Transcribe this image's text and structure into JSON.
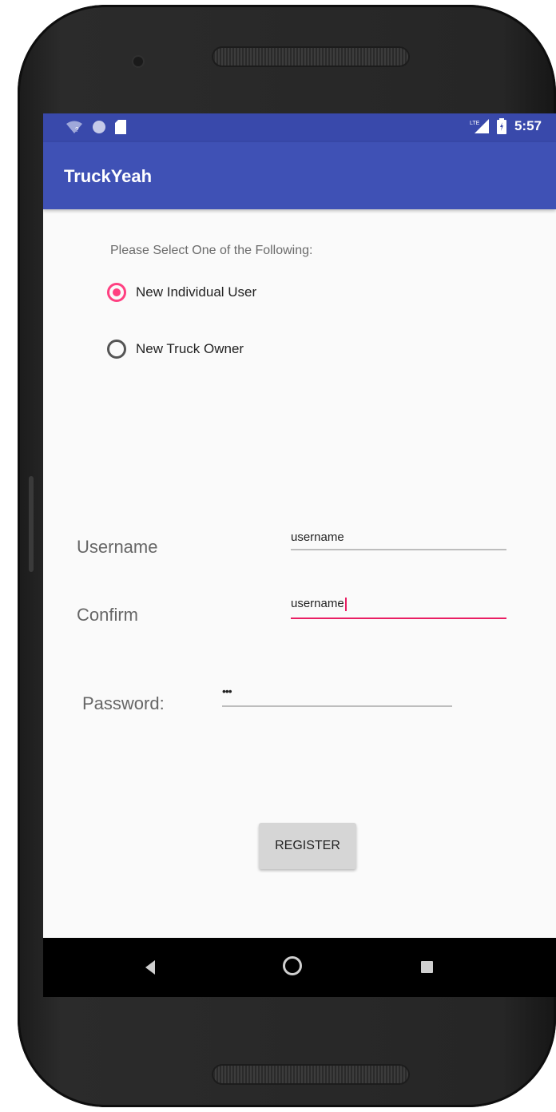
{
  "status_bar": {
    "time": "5:57",
    "icons": [
      "wifi-icon",
      "circle-notification-icon",
      "sd-card-icon",
      "lte-signal-icon",
      "battery-icon"
    ]
  },
  "app": {
    "title": "TruckYeah",
    "primary_color": "#3f51b5",
    "status_bar_color": "#3949ab",
    "accent_color": "#ff4081"
  },
  "form": {
    "prompt": "Please Select One of the Following:",
    "options": [
      {
        "label": "New Individual User",
        "checked": true
      },
      {
        "label": "New Truck Owner",
        "checked": false
      }
    ],
    "username_label": "Username",
    "username_value": "username",
    "confirm_label": "Confirm",
    "confirm_value": "username",
    "password_label": "Password:",
    "password_value": "•••",
    "register_label": "REGISTER"
  },
  "nav_bar": {
    "icons": [
      "back-icon",
      "home-icon",
      "recents-icon"
    ]
  }
}
